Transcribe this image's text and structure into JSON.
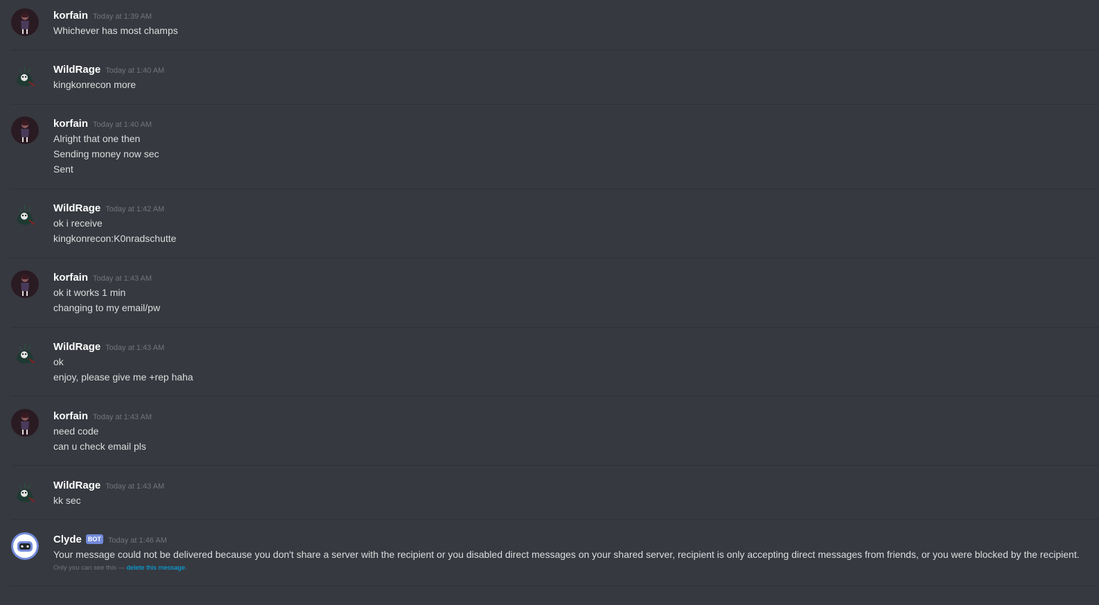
{
  "messages": [
    {
      "author": "korfain",
      "timestamp": "Today at 1:39 AM",
      "avatar": "korfain-avatar",
      "lines": [
        "Whichever has most champs"
      ]
    },
    {
      "author": "WildRage",
      "timestamp": "Today at 1:40 AM",
      "avatar": "wildrage-avatar",
      "lines": [
        "kingkonrecon more"
      ]
    },
    {
      "author": "korfain",
      "timestamp": "Today at 1:40 AM",
      "avatar": "korfain-avatar",
      "lines": [
        "Alright that one then",
        "Sending money now sec",
        "Sent"
      ]
    },
    {
      "author": "WildRage",
      "timestamp": "Today at 1:42 AM",
      "avatar": "wildrage-avatar",
      "lines": [
        "ok i receive",
        "kingkonrecon:K0nradschutte"
      ]
    },
    {
      "author": "korfain",
      "timestamp": "Today at 1:43 AM",
      "avatar": "korfain-avatar",
      "lines": [
        "ok it works 1 min",
        "changing to my email/pw"
      ]
    },
    {
      "author": "WildRage",
      "timestamp": "Today at 1:43 AM",
      "avatar": "wildrage-avatar",
      "lines": [
        "ok",
        "enjoy, please give me +rep haha"
      ]
    },
    {
      "author": "korfain",
      "timestamp": "Today at 1:43 AM",
      "avatar": "korfain-avatar",
      "lines": [
        "need code",
        "can u check email pls"
      ]
    },
    {
      "author": "WildRage",
      "timestamp": "Today at 1:43 AM",
      "avatar": "wildrage-avatar",
      "lines": [
        "kk sec"
      ]
    },
    {
      "author": "Clyde",
      "bot_tag": "BOT",
      "timestamp": "Today at 1:46 AM",
      "avatar": "clyde-bot-avatar",
      "lines": [
        "Your message could not be delivered because you don't share a server with the recipient or you disabled direct messages on your shared server, recipient is only accepting direct messages from friends, or you were blocked by the recipient."
      ],
      "notice": {
        "prefix": "Only you can see this — ",
        "link": "delete this message."
      }
    }
  ],
  "colors": {
    "background": "#36393f",
    "divider": "#2f3136",
    "username": "#ffffff",
    "timestamp": "#72767d",
    "text": "#dcddde",
    "bot_tag": "#7289da",
    "link": "#00b0f4",
    "clyde_avatar": "#7289da"
  }
}
